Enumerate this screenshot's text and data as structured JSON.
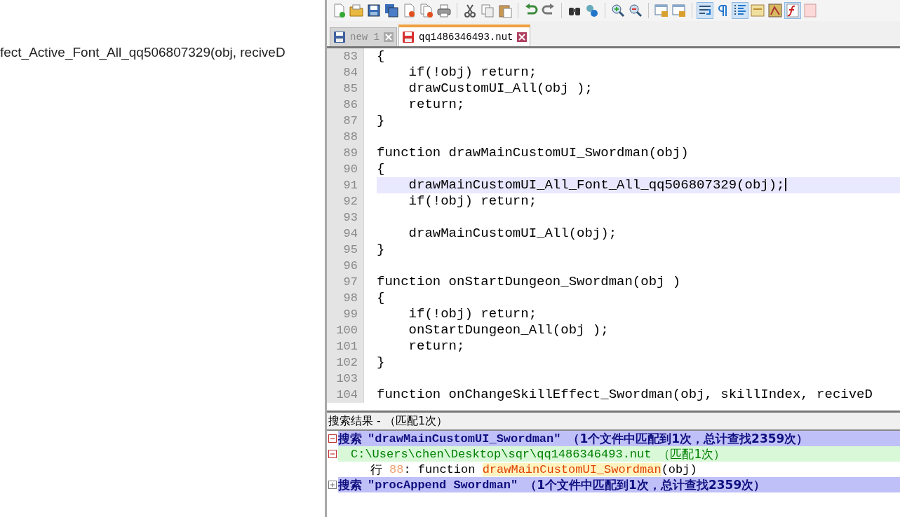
{
  "background_doc": {
    "line": "fect_Active_Font_All_qq506807329(obj, reciveD"
  },
  "tabs": [
    {
      "label": "new 1",
      "selected": false,
      "modified": false
    },
    {
      "label": "qq1486346493.nut",
      "selected": true,
      "modified": true
    }
  ],
  "editor": {
    "lines": [
      {
        "number": "83",
        "text": "{",
        "current": false
      },
      {
        "number": "84",
        "text": "    if(!obj) return;",
        "current": false
      },
      {
        "number": "85",
        "text": "    drawCustomUI_All(obj );",
        "current": false
      },
      {
        "number": "86",
        "text": "    return;",
        "current": false
      },
      {
        "number": "87",
        "text": "}",
        "current": false
      },
      {
        "number": "88",
        "current": false
      },
      {
        "number": "89",
        "text": "function drawMainCustomUI_Swordman(obj)",
        "current": false
      },
      {
        "number": "90",
        "text": "{",
        "current": false
      },
      {
        "number": "91",
        "text": "    drawMainCustomUI_All_Font_All_qq506807329(obj);",
        "current": true
      },
      {
        "number": "92",
        "text": "    if(!obj) return;",
        "current": false
      },
      {
        "number": "93",
        "current": false
      },
      {
        "number": "94",
        "text": "    drawMainCustomUI_All(obj);",
        "current": false
      },
      {
        "number": "95",
        "text": "}",
        "current": false
      },
      {
        "number": "96",
        "current": false
      },
      {
        "number": "97",
        "text": "function onStartDungeon_Swordman(obj )",
        "current": false
      },
      {
        "number": "98",
        "text": "{",
        "current": false
      },
      {
        "number": "99",
        "text": "    if(!obj) return;",
        "current": false
      },
      {
        "number": "100",
        "text": "    onStartDungeon_All(obj );",
        "current": false
      },
      {
        "number": "101",
        "text": "    return;",
        "current": false
      },
      {
        "number": "102",
        "text": "}",
        "current": false
      },
      {
        "number": "103",
        "current": false
      },
      {
        "number": "104",
        "text": "function onChangeSkillEffect_Swordman(obj, skillIndex, reciveD",
        "current": false
      }
    ]
  },
  "search_results": {
    "title": "搜索结果 - （匹配1次）",
    "searches": [
      {
        "expanded": true,
        "keyword": "搜索",
        "query": "\"drawMainCustomUI_Swordman\"",
        "summary": "（1个文件中匹配到1次，总计查找2359次）",
        "files": [
          {
            "expanded": true,
            "path": "C:\\Users\\chen\\Desktop\\sqr\\qq1486346493.nut",
            "summary": "（匹配1次）",
            "hits": [
              {
                "label": "行",
                "line": "88",
                "before": ": function ",
                "match": "drawMainCustomUI_Swordman",
                "after": "(obj)"
              }
            ]
          }
        ]
      },
      {
        "expanded": false,
        "keyword": "搜索",
        "query": "\"procAppend Swordman\"",
        "summary": "（1个文件中匹配到1次，总计查找2359次）"
      }
    ]
  }
}
